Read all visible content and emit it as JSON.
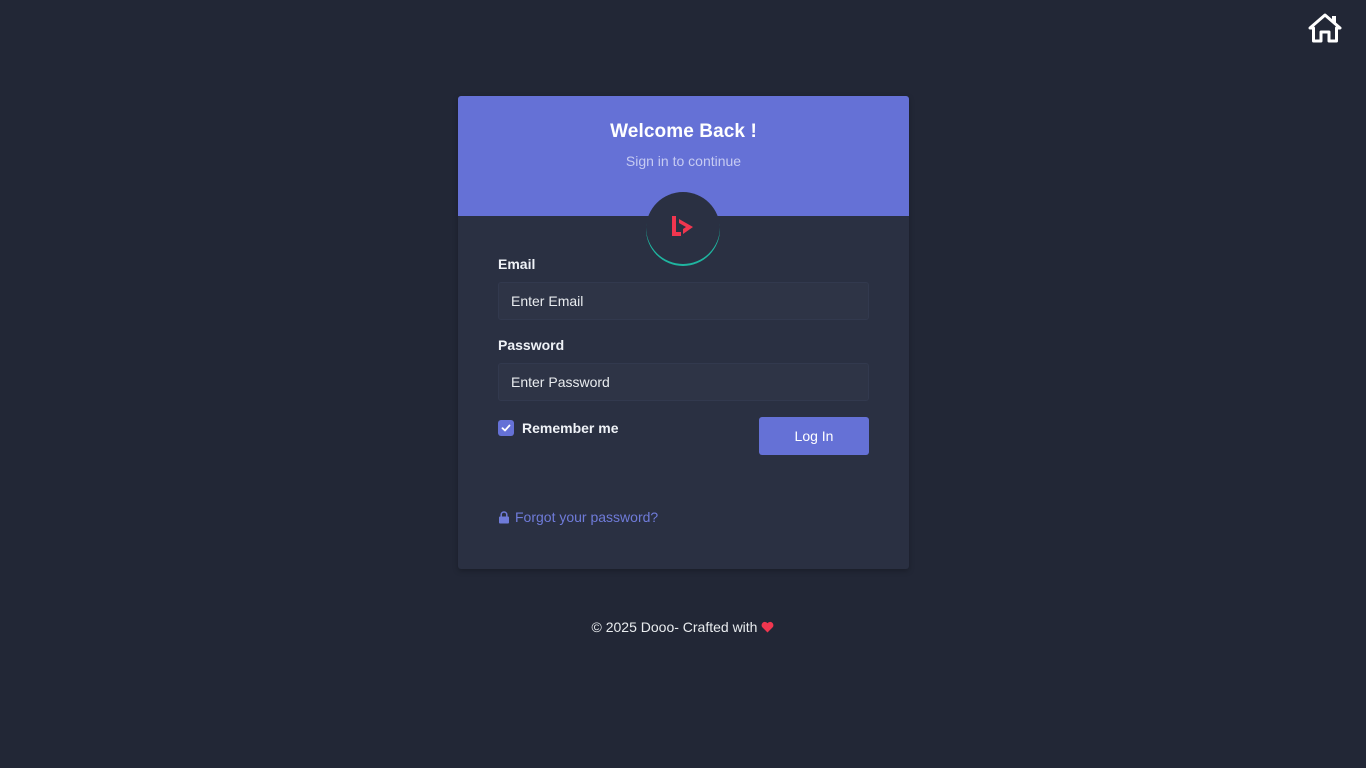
{
  "header": {
    "home_icon": "home-icon"
  },
  "card": {
    "title": "Welcome Back !",
    "subtitle": "Sign in to continue",
    "logo_icon": "brand-logo-icon"
  },
  "form": {
    "email_label": "Email",
    "email_placeholder": "Enter Email",
    "password_label": "Password",
    "password_placeholder": "Enter Password",
    "remember_label": "Remember me",
    "remember_checked": true,
    "login_label": "Log In",
    "forgot_label": "Forgot your password?",
    "forgot_icon": "lock-icon"
  },
  "footer": {
    "text": "© 2025 Dooo- Crafted with",
    "heart_icon": "heart-icon"
  },
  "colors": {
    "background": "#222736",
    "card": "#2a3042",
    "accent": "#6571d6",
    "logo_red": "#f0364f",
    "logo_ring": "#1fb5a0"
  }
}
